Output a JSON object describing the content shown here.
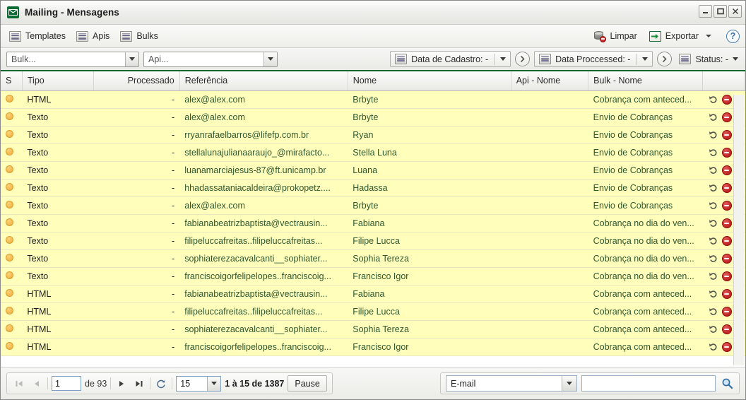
{
  "window": {
    "title": "Mailing - Mensagens",
    "app_icon": "envelope-icon",
    "minimize_label": "–",
    "maximize_label": "□",
    "close_label": "✕"
  },
  "toolbar": {
    "items": [
      {
        "label": "Templates",
        "icon": "list-icon"
      },
      {
        "label": "Apis",
        "icon": "list-icon"
      },
      {
        "label": "Bulks",
        "icon": "list-icon"
      }
    ],
    "clear_label": "Limpar",
    "clear_icon": "database-remove-icon",
    "export_label": "Exportar",
    "export_icon": "export-arrow-icon",
    "help_label": "?",
    "help_icon": "help-icon"
  },
  "filters": {
    "bulk": {
      "value": "Bulk...",
      "placeholder": "Bulk..."
    },
    "api": {
      "value": "Api...",
      "placeholder": "Api..."
    },
    "data_cadastro": {
      "label": "Data de Cadastro: -",
      "icon": "calendar-list-icon"
    },
    "data_processed": {
      "label": "Data Proccessed: -",
      "icon": "calendar-list-icon"
    },
    "status": {
      "label": "Status: -",
      "icon": "calendar-list-icon"
    },
    "go_icon": "circle-arrow-right-icon"
  },
  "grid": {
    "columns": [
      {
        "key": "s",
        "label": "S",
        "align": "left"
      },
      {
        "key": "tipo",
        "label": "Tipo",
        "align": "left"
      },
      {
        "key": "processado",
        "label": "Processado",
        "align": "right"
      },
      {
        "key": "referencia",
        "label": "Referência",
        "align": "left"
      },
      {
        "key": "nome",
        "label": "Nome",
        "align": "left"
      },
      {
        "key": "api_nome",
        "label": "Api - Nome",
        "align": "left"
      },
      {
        "key": "bulk_nome",
        "label": "Bulk - Nome",
        "align": "left"
      },
      {
        "key": "acoes",
        "label": "",
        "align": "left"
      }
    ],
    "rows": [
      {
        "status": "pending",
        "tipo": "HTML",
        "processado": "-",
        "referencia": "alex@alex.com",
        "nome": "Brbyte",
        "api_nome": "",
        "bulk_nome": "Cobrança com anteced..."
      },
      {
        "status": "pending",
        "tipo": "Texto",
        "processado": "-",
        "referencia": "alex@alex.com",
        "nome": "Brbyte",
        "api_nome": "",
        "bulk_nome": "Envio de Cobranças"
      },
      {
        "status": "pending",
        "tipo": "Texto",
        "processado": "-",
        "referencia": "rryanrafaelbarros@lifefp.com.br",
        "nome": "Ryan",
        "api_nome": "",
        "bulk_nome": "Envio de Cobranças"
      },
      {
        "status": "pending",
        "tipo": "Texto",
        "processado": "-",
        "referencia": "stellalunajulianaaraujo_@mirafacto...",
        "nome": "Stella Luna",
        "api_nome": "",
        "bulk_nome": "Envio de Cobranças"
      },
      {
        "status": "pending",
        "tipo": "Texto",
        "processado": "-",
        "referencia": "luanamarciajesus-87@ft.unicamp.br",
        "nome": "Luana",
        "api_nome": "",
        "bulk_nome": "Envio de Cobranças"
      },
      {
        "status": "pending",
        "tipo": "Texto",
        "processado": "-",
        "referencia": "hhadassataniacaldeira@prokopetz....",
        "nome": "Hadassa",
        "api_nome": "",
        "bulk_nome": "Envio de Cobranças"
      },
      {
        "status": "pending",
        "tipo": "Texto",
        "processado": "-",
        "referencia": "alex@alex.com",
        "nome": "Brbyte",
        "api_nome": "",
        "bulk_nome": "Envio de Cobranças"
      },
      {
        "status": "pending",
        "tipo": "Texto",
        "processado": "-",
        "referencia": "fabianabeatrizbaptista@vectrausin...",
        "nome": "Fabiana",
        "api_nome": "",
        "bulk_nome": "Cobrança no dia do ven..."
      },
      {
        "status": "pending",
        "tipo": "Texto",
        "processado": "-",
        "referencia": "filipeluccafreitas..filipeluccafreitas...",
        "nome": "Filipe Lucca",
        "api_nome": "",
        "bulk_nome": "Cobrança no dia do ven..."
      },
      {
        "status": "pending",
        "tipo": "Texto",
        "processado": "-",
        "referencia": "sophiaterezacavalcanti__sophiater...",
        "nome": "Sophia Tereza",
        "api_nome": "",
        "bulk_nome": "Cobrança no dia do ven..."
      },
      {
        "status": "pending",
        "tipo": "Texto",
        "processado": "-",
        "referencia": "franciscoigorfelipelopes..franciscoig...",
        "nome": "Francisco Igor",
        "api_nome": "",
        "bulk_nome": "Cobrança no dia do ven..."
      },
      {
        "status": "pending",
        "tipo": "HTML",
        "processado": "-",
        "referencia": "fabianabeatrizbaptista@vectrausin...",
        "nome": "Fabiana",
        "api_nome": "",
        "bulk_nome": "Cobrança com anteced..."
      },
      {
        "status": "pending",
        "tipo": "HTML",
        "processado": "-",
        "referencia": "filipeluccafreitas..filipeluccafreitas...",
        "nome": "Filipe Lucca",
        "api_nome": "",
        "bulk_nome": "Cobrança com anteced..."
      },
      {
        "status": "pending",
        "tipo": "HTML",
        "processado": "-",
        "referencia": "sophiaterezacavalcanti__sophiater...",
        "nome": "Sophia Tereza",
        "api_nome": "",
        "bulk_nome": "Cobrança com anteced..."
      },
      {
        "status": "pending",
        "tipo": "HTML",
        "processado": "-",
        "referencia": "franciscoigorfelipelopes..franciscoig...",
        "nome": "Francisco Igor",
        "api_nome": "",
        "bulk_nome": "Cobrança com anteced..."
      }
    ],
    "row_action_icons": [
      "undo-icon",
      "delete-icon"
    ]
  },
  "footer": {
    "first_icon": "first-page-icon",
    "prev_icon": "prev-page-icon",
    "page_value": "1",
    "page_of_label": "de 93",
    "next_icon": "next-page-icon",
    "last_icon": "last-page-icon",
    "refresh_icon": "refresh-icon",
    "page_size": "15",
    "range_label": "1 à 15 de 1387",
    "pause_label": "Pause",
    "search_field": {
      "value": "E-mail"
    },
    "search_input": {
      "value": "",
      "placeholder": ""
    },
    "search_icon": "magnifier-icon"
  },
  "colors": {
    "row_background": "#ffffbb",
    "row_text": "#2e5730",
    "accent_green": "#12682f",
    "status_dot": "#eeac3a",
    "delete_red": "#b40f0f"
  }
}
